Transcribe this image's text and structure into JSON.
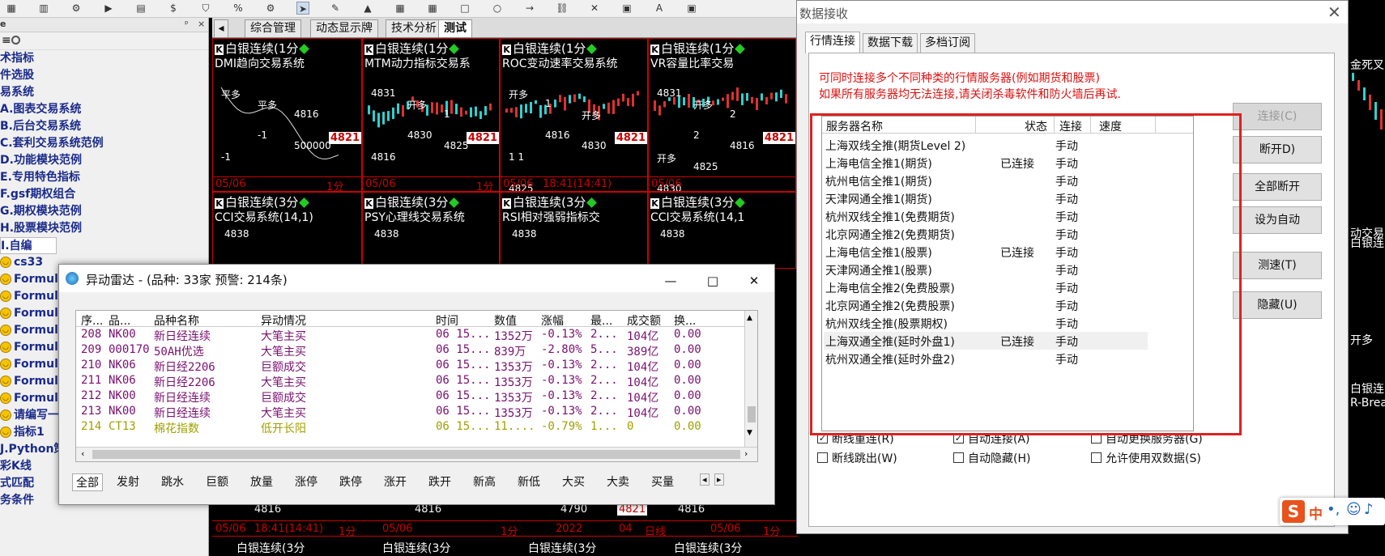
{
  "colors": {
    "accent_red": "#e01010",
    "nav_blue": "#1a2a8a",
    "chart_bg": "#000000",
    "candle_up": "#e03030",
    "candle_down": "#30d0d0"
  },
  "toolbar": {
    "icons": [
      "grid-icon",
      "bar-chart-icon",
      "settings-icon",
      "play-icon",
      "doc-icon",
      "dollar-icon",
      "filter-icon",
      "percent-icon",
      "gear-icon",
      "cursor-icon",
      "pencil-icon",
      "chart-icon",
      "calendar-icon",
      "grid-icon",
      "square-icon",
      "circle-icon",
      "arrow-icon",
      "link-icon",
      "close-icon",
      "save-icon",
      "font-icon",
      "mark-icon"
    ]
  },
  "left_panel": {
    "pin": "ᵖ",
    "close": "×",
    "items": [
      "术指标",
      "件选股",
      "易系统",
      "A.图表交易系统",
      "B.后台交易系统",
      "C.套利交易系统范例",
      "D.功能模块范例",
      "E.专用特色指标",
      "F.gsf期权组合",
      "G.期权模块范例",
      "H.股票模块范例",
      "I.自编",
      "cs33",
      "Formul",
      "Formul",
      "Formul",
      "Formul",
      "Formul",
      "Formul",
      "Formul",
      "Formul",
      "请编写一",
      "指标1",
      "J.Python策略范例",
      "彩K线",
      "式匹配",
      "务条件"
    ]
  },
  "main_tabs": [
    "综合管理",
    "动态显示牌",
    "技术分析",
    "测试"
  ],
  "charts": {
    "cells": [
      {
        "title": "白银连续(1分",
        "system": "DMI趋向交易系统",
        "level": "4821",
        "labels": [
          "平多",
          "平多",
          "4816",
          "-1",
          "-1",
          "500000"
        ],
        "date": "05/06",
        "period": "1分"
      },
      {
        "title": "白银连续(1分",
        "system": "MTM动力指标交易系",
        "level": "4821",
        "labels": [
          "4831",
          "开多",
          "1",
          "4816",
          "4830",
          "4825"
        ],
        "date": "05/06",
        "period": "1分"
      },
      {
        "title": "白银连续(1分",
        "system": "ROC变动速率交易系统",
        "level": "4821",
        "labels": [
          "开多",
          "1",
          "开多",
          "1 1",
          "4816",
          "4830",
          "4825"
        ],
        "date": "05/06",
        "period": "18:41(14:41)"
      },
      {
        "title": "白银连续(1分",
        "system": "VR容量比率交易",
        "level": "4821",
        "labels": [
          "4831",
          "开多",
          "2",
          "开多",
          "2",
          "4816",
          "4830",
          "4825"
        ],
        "date": "05/06",
        "period": ""
      },
      {
        "title": "白银连续(3分",
        "system": "CCI交易系统(14,1)",
        "level": "",
        "labels": [
          "4838"
        ],
        "date": "",
        "period": ""
      },
      {
        "title": "白银连续(3分",
        "system": "PSY心理线交易系统",
        "level": "",
        "labels": [
          "4838"
        ],
        "date": "",
        "period": ""
      },
      {
        "title": "白银连续(3分",
        "system": "RSI相对强弱指标交",
        "level": "",
        "labels": [
          "4838"
        ],
        "date": "",
        "period": ""
      },
      {
        "title": "白银连续(3分",
        "system": "CCI交易系统(14,1",
        "level": "",
        "labels": [
          "4838"
        ],
        "date": "",
        "period": ""
      }
    ],
    "bottom_labels": [
      "4816",
      "4816",
      "4790",
      "4821",
      "4816"
    ],
    "bottom_dates": [
      "05/06",
      "18:41(14:41)",
      "1分",
      "05/06",
      "1分",
      "2022",
      "04",
      "日线",
      "05/06",
      "1分"
    ],
    "bottom_titles": [
      "白银连续(3分",
      "白银连续(3分",
      "白银连续(3分",
      "白银连续(3分"
    ]
  },
  "radar": {
    "title": "异动雷达 - (品种: 33家  预警: 214条)",
    "columns": [
      "序...",
      "品...",
      "品种名称",
      "异动情况",
      "时间",
      "数值",
      "涨幅",
      "最...",
      "成交额",
      "换..."
    ],
    "rows": [
      {
        "seq": "208",
        "code": "NK00",
        "name": "新日经连续",
        "event": "大笔主买",
        "time": "06 15...",
        "value": "1352万",
        "change": "-0.13%",
        "high": "2...",
        "amount": "104亿",
        "turn": "0.00",
        "color": "#7a1070"
      },
      {
        "seq": "209",
        "code": "000170",
        "name": "50AH优选",
        "event": "大笔主买",
        "time": "06 15...",
        "value": "839万",
        "change": "-2.80%",
        "high": "5...",
        "amount": "389亿",
        "turn": "0.00",
        "color": "#7a1070"
      },
      {
        "seq": "210",
        "code": "NK06",
        "name": "新日经2206",
        "event": "巨额成交",
        "time": "06 15...",
        "value": "1353万",
        "change": "-0.13%",
        "high": "2...",
        "amount": "104亿",
        "turn": "0.00",
        "color": "#7a1070"
      },
      {
        "seq": "211",
        "code": "NK06",
        "name": "新日经2206",
        "event": "大笔主买",
        "time": "06 15...",
        "value": "1353万",
        "change": "-0.13%",
        "high": "2...",
        "amount": "104亿",
        "turn": "0.00",
        "color": "#7a1070"
      },
      {
        "seq": "212",
        "code": "NK00",
        "name": "新日经连续",
        "event": "巨额成交",
        "time": "06 15...",
        "value": "1353万",
        "change": "-0.13%",
        "high": "2...",
        "amount": "104亿",
        "turn": "0.00",
        "color": "#7a1070"
      },
      {
        "seq": "213",
        "code": "NK00",
        "name": "新日经连续",
        "event": "大笔主买",
        "time": "06 15...",
        "value": "1353万",
        "change": "-0.13%",
        "high": "2...",
        "amount": "104亿",
        "turn": "0.00",
        "color": "#7a1070"
      },
      {
        "seq": "214",
        "code": "CT13",
        "name": "棉花指数",
        "event": "低开长阳",
        "time": "06 15...",
        "value": "11....",
        "change": "-0.79%",
        "high": "1...",
        "amount": "0",
        "turn": "0.00",
        "color": "#a0a000"
      }
    ],
    "tabs": [
      "全部",
      "发射",
      "跳水",
      "巨额",
      "放量",
      "涨停",
      "跌停",
      "涨开",
      "跌开",
      "新高",
      "新低",
      "大买",
      "大卖",
      "买量"
    ]
  },
  "dialog": {
    "title": "数据接收",
    "tabs": [
      "行情连接",
      "数据下载",
      "多档订阅"
    ],
    "notice1": "可同时连接多个不同种类的行情服务器(例如期货和股票)",
    "notice2": "如果所有服务器均无法连接,请关闭杀毒软件和防火墙后再试.",
    "headers": [
      "服务器名称",
      "状态",
      "连接",
      "速度"
    ],
    "servers": [
      {
        "name": "上海双线全推(期货Level 2)",
        "status": "",
        "mode": "手动"
      },
      {
        "name": "上海电信全推1(期货)",
        "status": "已连接",
        "mode": "手动"
      },
      {
        "name": "杭州电信全推1(期货)",
        "status": "",
        "mode": "手动"
      },
      {
        "name": "天津网通全推1(期货)",
        "status": "",
        "mode": "手动"
      },
      {
        "name": "杭州双线全推1(免费期货)",
        "status": "",
        "mode": "手动"
      },
      {
        "name": "北京网通全推2(免费期货)",
        "status": "",
        "mode": "手动"
      },
      {
        "name": "上海电信全推1(股票)",
        "status": "已连接",
        "mode": "手动"
      },
      {
        "name": "天津网通全推1(股票)",
        "status": "",
        "mode": "手动"
      },
      {
        "name": "上海电信全推2(免费股票)",
        "status": "",
        "mode": "手动"
      },
      {
        "name": "北京网通全推2(免费股票)",
        "status": "",
        "mode": "手动"
      },
      {
        "name": "杭州双线全推(股票期权)",
        "status": "",
        "mode": "手动"
      },
      {
        "name": "上海双通全推(延时外盘1)",
        "status": "已连接",
        "mode": "手动"
      },
      {
        "name": "杭州双通全推(延时外盘2)",
        "status": "",
        "mode": "手动"
      }
    ],
    "buttons": [
      "连接(C)",
      "断开D)",
      "全部断开",
      "设为自动",
      "测速(T)",
      "隐藏(U)"
    ],
    "checks": [
      {
        "label": "断线重连(R)",
        "checked": "✓"
      },
      {
        "label": "自动连接(A)",
        "checked": "✓"
      },
      {
        "label": "自动更换服务器(G)",
        "checked": ""
      },
      {
        "label": "断线跳出(W)",
        "checked": ""
      },
      {
        "label": "自动隐藏(H)",
        "checked": ""
      },
      {
        "label": "允许使用双数据(S)",
        "checked": ""
      }
    ]
  },
  "right_strip": {
    "labels": [
      "金死叉",
      "白银连",
      "白银连",
      "R-Brea",
      "开多",
      "动交易"
    ]
  },
  "ime": {
    "label": "中"
  }
}
